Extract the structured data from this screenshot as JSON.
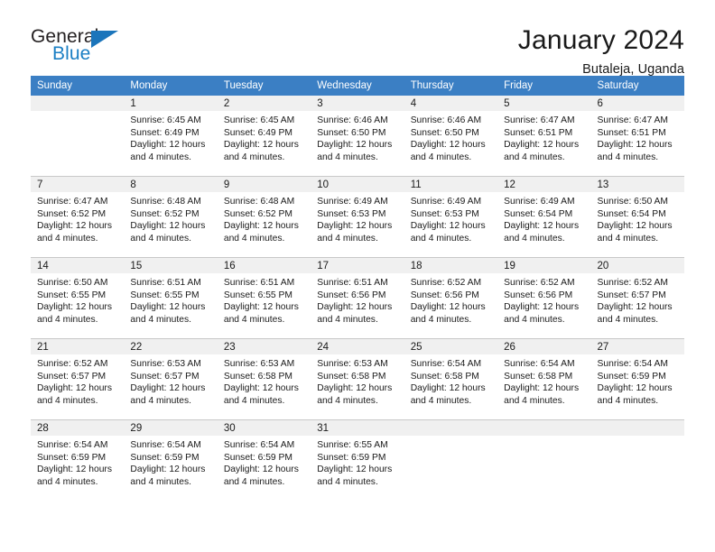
{
  "brand": {
    "word_one": "General",
    "word_two": "Blue",
    "accent_color": "#1b75bb"
  },
  "header": {
    "title": "January 2024",
    "subtitle": "Butaleja, Uganda"
  },
  "calendar": {
    "header_bg": "#3b7fc4",
    "daynum_bg": "#f0f0f0",
    "weekday_headers": [
      "Sunday",
      "Monday",
      "Tuesday",
      "Wednesday",
      "Thursday",
      "Friday",
      "Saturday"
    ],
    "weeks": [
      [
        {
          "day": "",
          "sunrise": "",
          "sunset": "",
          "daylight_line1": "",
          "daylight_line2": ""
        },
        {
          "day": "1",
          "sunrise": "Sunrise: 6:45 AM",
          "sunset": "Sunset: 6:49 PM",
          "daylight_line1": "Daylight: 12 hours",
          "daylight_line2": "and 4 minutes."
        },
        {
          "day": "2",
          "sunrise": "Sunrise: 6:45 AM",
          "sunset": "Sunset: 6:49 PM",
          "daylight_line1": "Daylight: 12 hours",
          "daylight_line2": "and 4 minutes."
        },
        {
          "day": "3",
          "sunrise": "Sunrise: 6:46 AM",
          "sunset": "Sunset: 6:50 PM",
          "daylight_line1": "Daylight: 12 hours",
          "daylight_line2": "and 4 minutes."
        },
        {
          "day": "4",
          "sunrise": "Sunrise: 6:46 AM",
          "sunset": "Sunset: 6:50 PM",
          "daylight_line1": "Daylight: 12 hours",
          "daylight_line2": "and 4 minutes."
        },
        {
          "day": "5",
          "sunrise": "Sunrise: 6:47 AM",
          "sunset": "Sunset: 6:51 PM",
          "daylight_line1": "Daylight: 12 hours",
          "daylight_line2": "and 4 minutes."
        },
        {
          "day": "6",
          "sunrise": "Sunrise: 6:47 AM",
          "sunset": "Sunset: 6:51 PM",
          "daylight_line1": "Daylight: 12 hours",
          "daylight_line2": "and 4 minutes."
        }
      ],
      [
        {
          "day": "7",
          "sunrise": "Sunrise: 6:47 AM",
          "sunset": "Sunset: 6:52 PM",
          "daylight_line1": "Daylight: 12 hours",
          "daylight_line2": "and 4 minutes."
        },
        {
          "day": "8",
          "sunrise": "Sunrise: 6:48 AM",
          "sunset": "Sunset: 6:52 PM",
          "daylight_line1": "Daylight: 12 hours",
          "daylight_line2": "and 4 minutes."
        },
        {
          "day": "9",
          "sunrise": "Sunrise: 6:48 AM",
          "sunset": "Sunset: 6:52 PM",
          "daylight_line1": "Daylight: 12 hours",
          "daylight_line2": "and 4 minutes."
        },
        {
          "day": "10",
          "sunrise": "Sunrise: 6:49 AM",
          "sunset": "Sunset: 6:53 PM",
          "daylight_line1": "Daylight: 12 hours",
          "daylight_line2": "and 4 minutes."
        },
        {
          "day": "11",
          "sunrise": "Sunrise: 6:49 AM",
          "sunset": "Sunset: 6:53 PM",
          "daylight_line1": "Daylight: 12 hours",
          "daylight_line2": "and 4 minutes."
        },
        {
          "day": "12",
          "sunrise": "Sunrise: 6:49 AM",
          "sunset": "Sunset: 6:54 PM",
          "daylight_line1": "Daylight: 12 hours",
          "daylight_line2": "and 4 minutes."
        },
        {
          "day": "13",
          "sunrise": "Sunrise: 6:50 AM",
          "sunset": "Sunset: 6:54 PM",
          "daylight_line1": "Daylight: 12 hours",
          "daylight_line2": "and 4 minutes."
        }
      ],
      [
        {
          "day": "14",
          "sunrise": "Sunrise: 6:50 AM",
          "sunset": "Sunset: 6:55 PM",
          "daylight_line1": "Daylight: 12 hours",
          "daylight_line2": "and 4 minutes."
        },
        {
          "day": "15",
          "sunrise": "Sunrise: 6:51 AM",
          "sunset": "Sunset: 6:55 PM",
          "daylight_line1": "Daylight: 12 hours",
          "daylight_line2": "and 4 minutes."
        },
        {
          "day": "16",
          "sunrise": "Sunrise: 6:51 AM",
          "sunset": "Sunset: 6:55 PM",
          "daylight_line1": "Daylight: 12 hours",
          "daylight_line2": "and 4 minutes."
        },
        {
          "day": "17",
          "sunrise": "Sunrise: 6:51 AM",
          "sunset": "Sunset: 6:56 PM",
          "daylight_line1": "Daylight: 12 hours",
          "daylight_line2": "and 4 minutes."
        },
        {
          "day": "18",
          "sunrise": "Sunrise: 6:52 AM",
          "sunset": "Sunset: 6:56 PM",
          "daylight_line1": "Daylight: 12 hours",
          "daylight_line2": "and 4 minutes."
        },
        {
          "day": "19",
          "sunrise": "Sunrise: 6:52 AM",
          "sunset": "Sunset: 6:56 PM",
          "daylight_line1": "Daylight: 12 hours",
          "daylight_line2": "and 4 minutes."
        },
        {
          "day": "20",
          "sunrise": "Sunrise: 6:52 AM",
          "sunset": "Sunset: 6:57 PM",
          "daylight_line1": "Daylight: 12 hours",
          "daylight_line2": "and 4 minutes."
        }
      ],
      [
        {
          "day": "21",
          "sunrise": "Sunrise: 6:52 AM",
          "sunset": "Sunset: 6:57 PM",
          "daylight_line1": "Daylight: 12 hours",
          "daylight_line2": "and 4 minutes."
        },
        {
          "day": "22",
          "sunrise": "Sunrise: 6:53 AM",
          "sunset": "Sunset: 6:57 PM",
          "daylight_line1": "Daylight: 12 hours",
          "daylight_line2": "and 4 minutes."
        },
        {
          "day": "23",
          "sunrise": "Sunrise: 6:53 AM",
          "sunset": "Sunset: 6:58 PM",
          "daylight_line1": "Daylight: 12 hours",
          "daylight_line2": "and 4 minutes."
        },
        {
          "day": "24",
          "sunrise": "Sunrise: 6:53 AM",
          "sunset": "Sunset: 6:58 PM",
          "daylight_line1": "Daylight: 12 hours",
          "daylight_line2": "and 4 minutes."
        },
        {
          "day": "25",
          "sunrise": "Sunrise: 6:54 AM",
          "sunset": "Sunset: 6:58 PM",
          "daylight_line1": "Daylight: 12 hours",
          "daylight_line2": "and 4 minutes."
        },
        {
          "day": "26",
          "sunrise": "Sunrise: 6:54 AM",
          "sunset": "Sunset: 6:58 PM",
          "daylight_line1": "Daylight: 12 hours",
          "daylight_line2": "and 4 minutes."
        },
        {
          "day": "27",
          "sunrise": "Sunrise: 6:54 AM",
          "sunset": "Sunset: 6:59 PM",
          "daylight_line1": "Daylight: 12 hours",
          "daylight_line2": "and 4 minutes."
        }
      ],
      [
        {
          "day": "28",
          "sunrise": "Sunrise: 6:54 AM",
          "sunset": "Sunset: 6:59 PM",
          "daylight_line1": "Daylight: 12 hours",
          "daylight_line2": "and 4 minutes."
        },
        {
          "day": "29",
          "sunrise": "Sunrise: 6:54 AM",
          "sunset": "Sunset: 6:59 PM",
          "daylight_line1": "Daylight: 12 hours",
          "daylight_line2": "and 4 minutes."
        },
        {
          "day": "30",
          "sunrise": "Sunrise: 6:54 AM",
          "sunset": "Sunset: 6:59 PM",
          "daylight_line1": "Daylight: 12 hours",
          "daylight_line2": "and 4 minutes."
        },
        {
          "day": "31",
          "sunrise": "Sunrise: 6:55 AM",
          "sunset": "Sunset: 6:59 PM",
          "daylight_line1": "Daylight: 12 hours",
          "daylight_line2": "and 4 minutes."
        },
        {
          "day": "",
          "sunrise": "",
          "sunset": "",
          "daylight_line1": "",
          "daylight_line2": ""
        },
        {
          "day": "",
          "sunrise": "",
          "sunset": "",
          "daylight_line1": "",
          "daylight_line2": ""
        },
        {
          "day": "",
          "sunrise": "",
          "sunset": "",
          "daylight_line1": "",
          "daylight_line2": ""
        }
      ]
    ]
  }
}
